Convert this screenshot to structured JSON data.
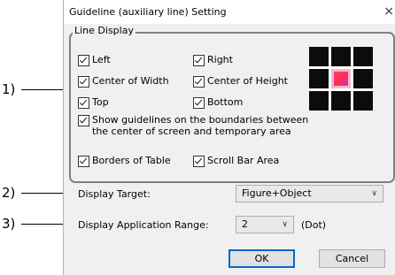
{
  "dialog": {
    "title": "Guideline (auxiliary line) Setting",
    "close_glyph": "×"
  },
  "line_display": {
    "title": "Line Display",
    "left": "Left",
    "right": "Right",
    "center_width": "Center of Width",
    "center_height": "Center of Height",
    "top": "Top",
    "bottom": "Bottom",
    "show_guidelines_line1": "Show guidelines on the boundaries between",
    "show_guidelines_line2": "the center of screen and temporary area",
    "borders_of_table": "Borders of Table",
    "scroll_bar_area": "Scroll Bar Area",
    "checked": {
      "left": true,
      "right": true,
      "center_width": true,
      "center_height": true,
      "top": true,
      "bottom": true,
      "show_guidelines": true,
      "borders_of_table": true,
      "scroll_bar_area": true
    }
  },
  "display_target": {
    "label": "Display Target:",
    "value": "Figure+Object"
  },
  "display_range": {
    "label": "Display Application Range:",
    "value": "2",
    "unit": "(Dot)"
  },
  "buttons": {
    "ok": "OK",
    "cancel": "Cancel"
  },
  "callouts": {
    "c1": "1)",
    "c2": "2)",
    "c3": "3)"
  },
  "icons": {
    "checkbox": "checkbox-checked-icon",
    "dropdown": "chevron-down-icon"
  },
  "colors": {
    "preview_center": "#ff2d55",
    "default_button_border": "#0a64c8"
  }
}
